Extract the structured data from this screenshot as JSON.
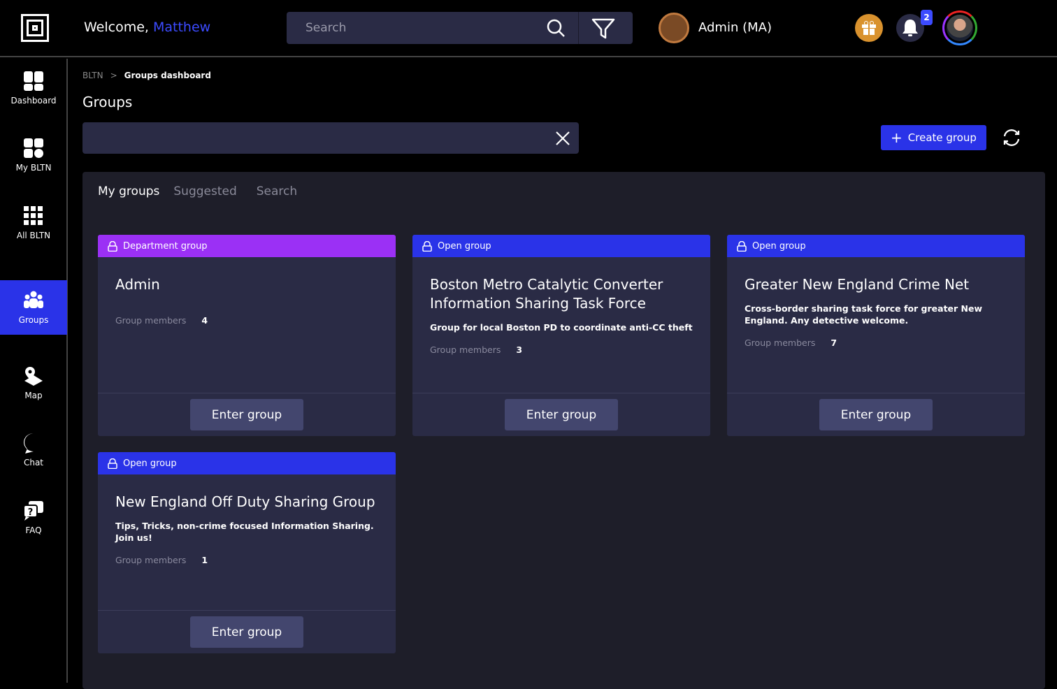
{
  "header": {
    "welcome": "Welcome,",
    "user_name": "Matthew",
    "search_placeholder": "Search",
    "agency": "Admin (MA)",
    "notification_count": "2"
  },
  "sidebar": {
    "items": [
      {
        "label": "Dashboard",
        "icon": "dashboard-icon"
      },
      {
        "label": "My BLTN",
        "icon": "my-bltn-icon"
      },
      {
        "label": "All BLTN",
        "icon": "grid-icon"
      },
      {
        "label": "Groups",
        "icon": "groups-icon",
        "active": true
      },
      {
        "label": "Map",
        "icon": "map-icon"
      },
      {
        "label": "Chat",
        "icon": "chat-icon"
      },
      {
        "label": "FAQ",
        "icon": "faq-icon"
      }
    ]
  },
  "breadcrumb": {
    "root": "BLTN",
    "sep": ">",
    "current": "Groups dashboard"
  },
  "page": {
    "title": "Groups",
    "filter_value": "",
    "create_label": "Create group"
  },
  "tabs": [
    {
      "label": "My groups"
    },
    {
      "label": "Suggested"
    },
    {
      "label": "Search"
    }
  ],
  "colors": {
    "department": "#9b30f5",
    "open": "#2a33e8"
  },
  "groups": [
    {
      "type": "Department group",
      "name": "Admin",
      "description": "",
      "members_label": "Group members",
      "members": "4",
      "button": "Enter group"
    },
    {
      "type": "Open group",
      "name": "Boston Metro Catalytic Converter Information Sharing Task Force",
      "description": "Group for local Boston PD to coordinate anti-CC theft",
      "members_label": "Group members",
      "members": "3",
      "button": "Enter group"
    },
    {
      "type": "Open group",
      "name": "Greater New England Crime Net",
      "description": "Cross-border sharing task force for greater New England. Any detective welcome.",
      "members_label": "Group members",
      "members": "7",
      "button": "Enter group"
    },
    {
      "type": "Open group",
      "name": "New England Off Duty Sharing Group",
      "description": "Tips, Tricks, non-crime focused Information Sharing. Join us!",
      "members_label": "Group members",
      "members": "1",
      "button": "Enter group"
    }
  ]
}
